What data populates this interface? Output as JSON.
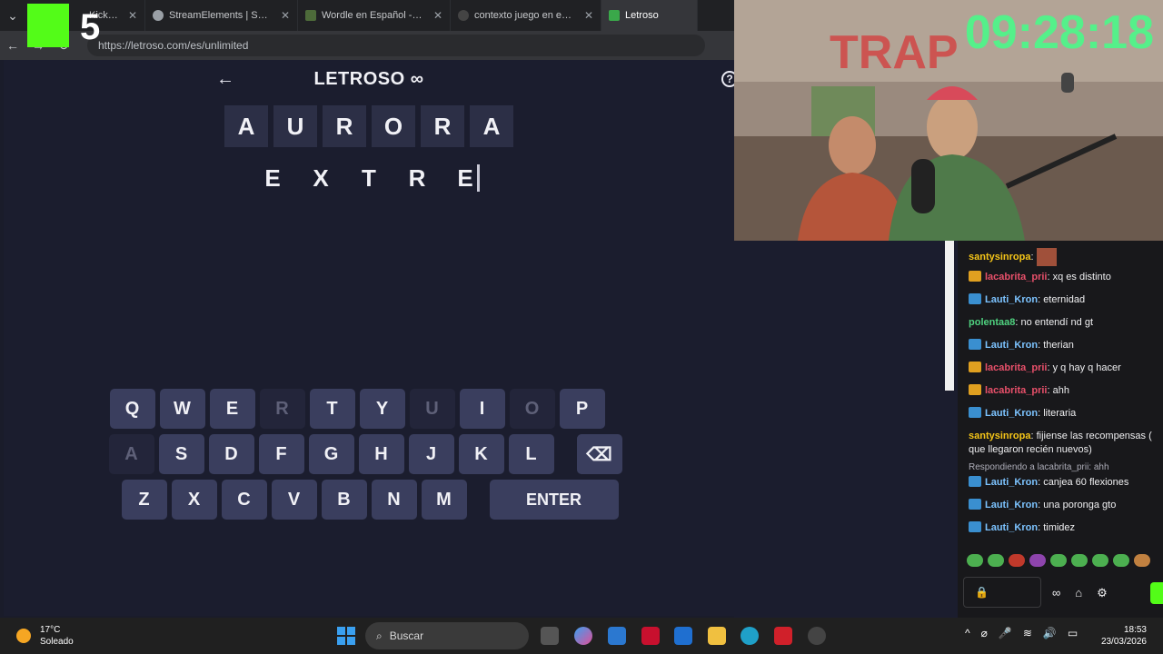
{
  "browser": {
    "tabs": [
      {
        "title": "Kick Dashboard",
        "shown": "...eam...ick Dashboard",
        "active": false,
        "fav": "#2b2b2b"
      },
      {
        "title": "StreamElements | Subathon",
        "active": false,
        "fav": "#9aa0a6"
      },
      {
        "title": "Wordle en Español - Juego",
        "active": false,
        "fav": "#4d6b3a"
      },
      {
        "title": "contexto juego en español",
        "active": false,
        "fav": "#555"
      },
      {
        "title": "Letroso",
        "active": true,
        "fav": "#3aa84a"
      }
    ],
    "close_glyph": "✕",
    "url": "https://letroso.com/es/unlimited"
  },
  "overlay": {
    "k_number": "5"
  },
  "game": {
    "back_glyph": "←",
    "logo": "LETROSO ∞",
    "help_glyph": "?",
    "guess_row": [
      "A",
      "U",
      "R",
      "O",
      "R",
      "A"
    ],
    "typing_row": [
      "E",
      "X",
      "T",
      "R",
      "E"
    ],
    "keyboard": {
      "row1": [
        {
          "k": "Q",
          "used": false
        },
        {
          "k": "W",
          "used": false
        },
        {
          "k": "E",
          "used": false
        },
        {
          "k": "R",
          "used": true
        },
        {
          "k": "T",
          "used": false
        },
        {
          "k": "Y",
          "used": false
        },
        {
          "k": "U",
          "used": true
        },
        {
          "k": "I",
          "used": false
        },
        {
          "k": "O",
          "used": true
        },
        {
          "k": "P",
          "used": false
        }
      ],
      "row2": [
        {
          "k": "A",
          "used": true
        },
        {
          "k": "S",
          "used": false
        },
        {
          "k": "D",
          "used": false
        },
        {
          "k": "F",
          "used": false
        },
        {
          "k": "G",
          "used": false
        },
        {
          "k": "H",
          "used": false
        },
        {
          "k": "J",
          "used": false
        },
        {
          "k": "K",
          "used": false
        },
        {
          "k": "L",
          "used": false
        }
      ],
      "backspace_glyph": "⌫",
      "row3": [
        {
          "k": "Z",
          "used": false
        },
        {
          "k": "X",
          "used": false
        },
        {
          "k": "C",
          "used": false
        },
        {
          "k": "V",
          "used": false
        },
        {
          "k": "B",
          "used": false
        },
        {
          "k": "N",
          "used": false
        },
        {
          "k": "M",
          "used": false
        }
      ],
      "enter": "ENTER"
    }
  },
  "stream": {
    "clock": "09:28:18",
    "chat": [
      {
        "user": "santysinropa",
        "text": "",
        "color": "#f5c518",
        "badge": null,
        "emote": true
      },
      {
        "user": "lacabrita_prii",
        "text": "xq es distinto",
        "color": "#e8506a",
        "badge": "#e0a020"
      },
      {
        "user": "Lauti_Kron",
        "text": "eternidad",
        "color": "#7cc3ff",
        "badge": "#3a8fd0"
      },
      {
        "user": "polentaa8",
        "text": "no entendí nd gt",
        "color": "#4fd17f",
        "badge": null
      },
      {
        "user": "Lauti_Kron",
        "text": "therian",
        "color": "#7cc3ff",
        "badge": "#3a8fd0"
      },
      {
        "user": "lacabrita_prii",
        "text": "y q hay q hacer",
        "color": "#e8506a",
        "badge": "#e0a020"
      },
      {
        "user": "lacabrita_prii",
        "text": "ahh",
        "color": "#e8506a",
        "badge": "#e0a020"
      },
      {
        "user": "Lauti_Kron",
        "text": "literaria",
        "color": "#7cc3ff",
        "badge": "#3a8fd0"
      },
      {
        "user": "santysinropa",
        "text": "fijiense las recompensas ( que llegaron recién nuevos)",
        "color": "#f5c518",
        "badge": null
      },
      {
        "reply": "Respondiendo a lacabrita_prii: ahh"
      },
      {
        "user": "Lauti_Kron",
        "text": "canjea 60 flexiones",
        "color": "#7cc3ff",
        "badge": "#3a8fd0"
      },
      {
        "user": "Lauti_Kron",
        "text": "una poronga gto",
        "color": "#7cc3ff",
        "badge": "#3a8fd0"
      },
      {
        "user": "Lauti_Kron",
        "text": "timidez",
        "color": "#7cc3ff",
        "badge": "#3a8fd0"
      }
    ],
    "input_lock_glyph": "🔒",
    "icons": [
      "∞",
      "⌂",
      "⚙"
    ]
  },
  "taskbar": {
    "temp": "17°C",
    "weather": "Soleado",
    "search_placeholder": "Buscar",
    "time": "18:53",
    "date": "23/03/2026",
    "tray": [
      "^",
      "⌀",
      "🎤",
      "≋",
      "🔊",
      "▭"
    ]
  }
}
